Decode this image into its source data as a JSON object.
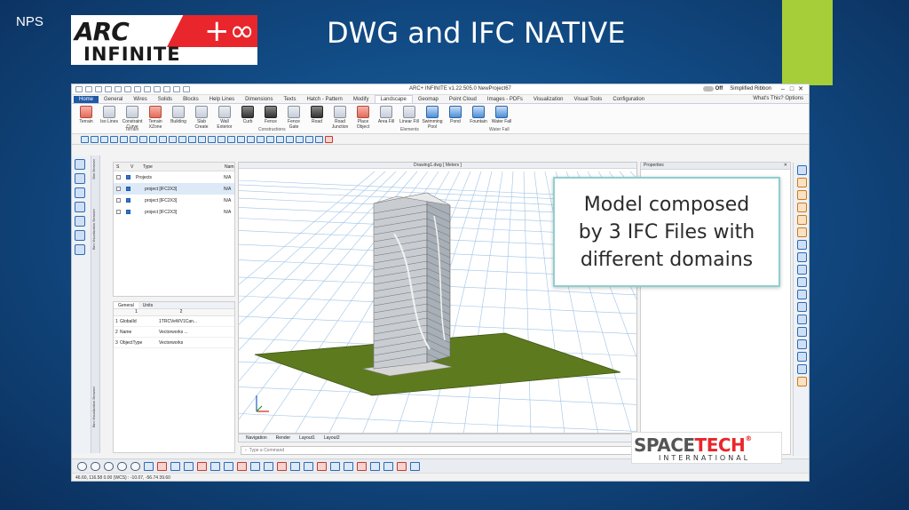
{
  "slide": {
    "corner_label": "NPS",
    "headline": "DWG and IFC NATIVE",
    "logo": {
      "line1": "ARC",
      "symbol": "+∞",
      "line2": "INFINITE"
    },
    "accent_color": "#a6ce39",
    "background_color": "#124d87"
  },
  "app": {
    "title": "ARC+ INFINITE v1.22.505.0 NewProject67",
    "toggle_label": "Off",
    "mode_label": "Simplified Ribbon",
    "window_controls": [
      "–",
      "□",
      "✕"
    ],
    "tabs": [
      "Home",
      "General",
      "Wires",
      "Solids",
      "Blocks",
      "Help Lines",
      "Dimensions",
      "Texts",
      "Hatch - Pattern",
      "Modify",
      "Landscape",
      "Geomap",
      "Point Cloud",
      "Images - PDFs",
      "Visualization",
      "Visual Tools",
      "Configuration"
    ],
    "active_tab": "Landscape",
    "tabs_right": "What's This?   Options",
    "ribbon": {
      "buttons": [
        {
          "label": "Terrain",
          "icon": "terrain-icon"
        },
        {
          "label": "Iso Lines",
          "icon": "iso-lines-icon"
        },
        {
          "label": "Constraint Curve",
          "icon": "constraint-curve-icon"
        },
        {
          "label": "Terrain XZone",
          "icon": "terrain-xzone-icon"
        },
        {
          "label": "Building",
          "icon": "building-icon"
        },
        {
          "label": "Slab Create",
          "icon": "slab-create-icon"
        },
        {
          "label": "Wall Exterior",
          "icon": "wall-exterior-icon"
        },
        {
          "label": "Curb",
          "icon": "curb-icon"
        },
        {
          "label": "Fence",
          "icon": "fence-icon"
        },
        {
          "label": "Fence Gate",
          "icon": "fence-gate-icon"
        },
        {
          "label": "Road",
          "icon": "road-icon"
        },
        {
          "label": "Road Junction",
          "icon": "road-junction-icon"
        },
        {
          "label": "Place Object",
          "icon": "place-object-icon"
        },
        {
          "label": "Area Fill",
          "icon": "area-fill-icon"
        },
        {
          "label": "Linear Fill",
          "icon": "linear-fill-icon"
        },
        {
          "label": "Swimming Pool",
          "icon": "swimming-pool-icon"
        },
        {
          "label": "Pond",
          "icon": "pond-icon"
        },
        {
          "label": "Fountain",
          "icon": "fountain-icon"
        },
        {
          "label": "Water Fall",
          "icon": "water-fall-icon"
        }
      ],
      "groups": [
        "Terrain",
        "Constructions",
        "Elements",
        "Water Fall"
      ]
    },
    "tree": {
      "columns": [
        "S",
        "V",
        "Type",
        "Nam"
      ],
      "rows": [
        {
          "type": "Projects",
          "name": "N/A"
        },
        {
          "type": "project [IFC2X3]",
          "name": "N/A"
        },
        {
          "type": "project [IFC2X3]",
          "name": "N/A"
        },
        {
          "type": "project [IFC2X3]",
          "name": "N/A"
        }
      ]
    },
    "side_labels": [
      "Bim Browser",
      "Bim Visualization Browser",
      "Bim Visualization Browser"
    ],
    "properties_panel": {
      "tabs": [
        "General",
        "Units"
      ],
      "columns": [
        "1",
        "2"
      ],
      "rows": [
        {
          "n": "1",
          "key": "GlobalId",
          "value": "1TRCVeWV1Can..."
        },
        {
          "n": "2",
          "key": "Name",
          "value": "Vectorworks ..."
        },
        {
          "n": "3",
          "key": "ObjectType",
          "value": "Vectorworks"
        }
      ]
    },
    "viewport_title": "Drawing1.dwg [ Meters ]",
    "viewport_tabs": [
      "Navigation",
      "Render",
      "Layout1",
      "Layout2"
    ],
    "right_panel_title": "Properties",
    "command_line": "Type a Command",
    "status_text": "46.60, 116.58 0.00     (WCS) : -10.07, -56.74 39.60"
  },
  "callout": {
    "lines": [
      "Model composed",
      "by 3 IFC Files with",
      "different domains"
    ]
  },
  "watermark": {
    "brand_a": "SPACE",
    "brand_b": "TECH",
    "reg": "®",
    "sub": "INTERNATIONAL",
    "brand_color": "#e8262b"
  }
}
